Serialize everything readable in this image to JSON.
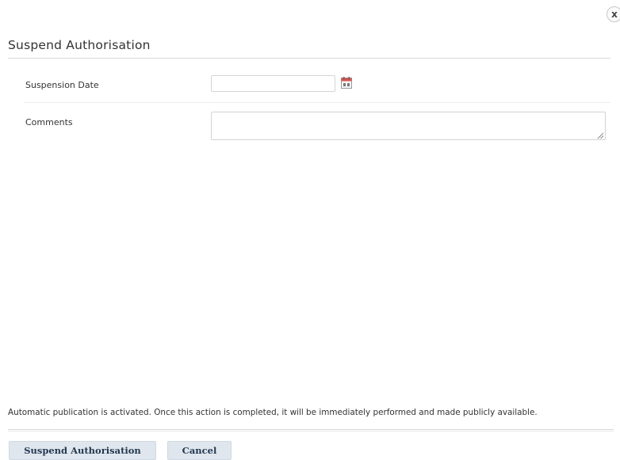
{
  "dialog": {
    "title": "Suspend Authorisation",
    "close_label": "x"
  },
  "form": {
    "suspension_date": {
      "label": "Suspension Date",
      "value": "",
      "calendar_icon": "calendar-icon"
    },
    "comments": {
      "label": "Comments",
      "value": ""
    }
  },
  "notice": "Automatic publication is activated. Once this action is completed, it will be immediately performed and made publicly available.",
  "buttons": {
    "suspend_label": "Suspend Authorisation",
    "cancel_label": "Cancel"
  },
  "colors": {
    "button_bg": "#dfe6ee",
    "button_text": "#23384f",
    "calendar_red": "#d9534f"
  }
}
